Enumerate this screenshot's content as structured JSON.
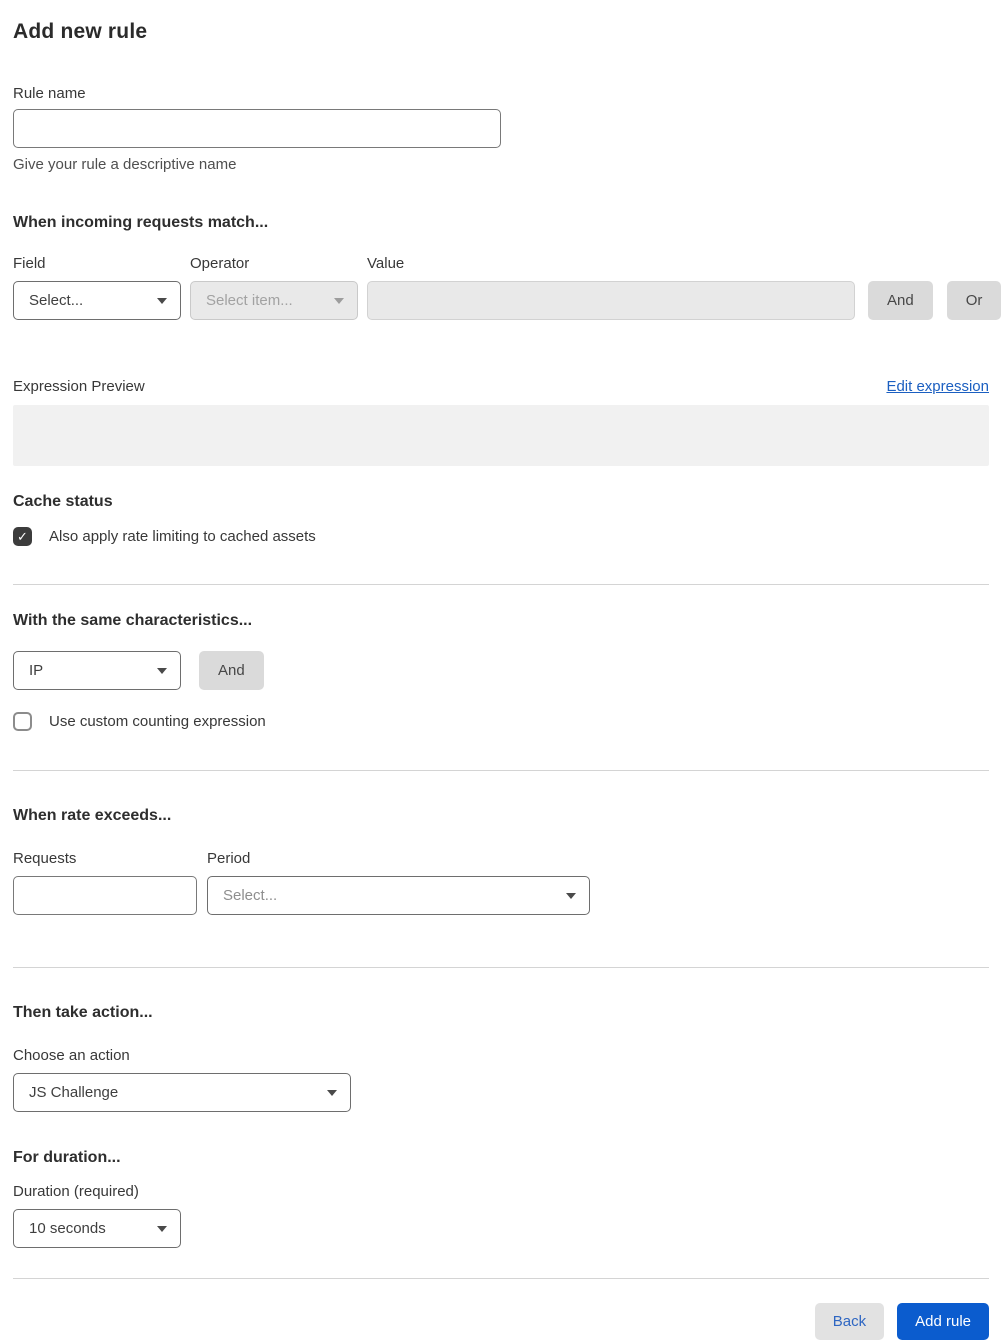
{
  "page": {
    "title": "Add new rule"
  },
  "icons": {
    "check": "✓"
  },
  "colors": {
    "primary_button": "#0b5cce",
    "link": "#1b5fc1",
    "disabled_bg": "#e9e9e9",
    "preview_bg": "#f1f1f1",
    "checkbox_checked": "#3c3c3c"
  },
  "rule_name": {
    "label": "Rule name",
    "value": "",
    "helper": "Give your rule a descriptive name"
  },
  "match": {
    "heading": "When incoming requests match...",
    "field": {
      "label": "Field",
      "selected": "Select..."
    },
    "operator": {
      "label": "Operator",
      "selected": "Select item...",
      "disabled": true
    },
    "value": {
      "label": "Value",
      "value": "",
      "disabled": true
    },
    "and_button": "And",
    "or_button": "Or"
  },
  "expression": {
    "label": "Expression Preview",
    "edit_link": "Edit expression",
    "preview_value": ""
  },
  "cache_status": {
    "heading": "Cache status",
    "checkbox_label": "Also apply rate limiting to cached assets",
    "checked": true
  },
  "characteristics": {
    "heading": "With the same characteristics...",
    "select_selected": "IP",
    "and_button": "And",
    "checkbox_label": "Use custom counting expression",
    "checked": false
  },
  "rate": {
    "heading": "When rate exceeds...",
    "requests": {
      "label": "Requests",
      "value": ""
    },
    "period": {
      "label": "Period",
      "selected": "Select..."
    }
  },
  "action": {
    "heading": "Then take action...",
    "label": "Choose an action",
    "selected": "JS Challenge"
  },
  "duration": {
    "heading": "For duration...",
    "label": "Duration (required)",
    "selected": "10 seconds"
  },
  "footer": {
    "back_button": "Back",
    "add_rule_button": "Add rule"
  }
}
